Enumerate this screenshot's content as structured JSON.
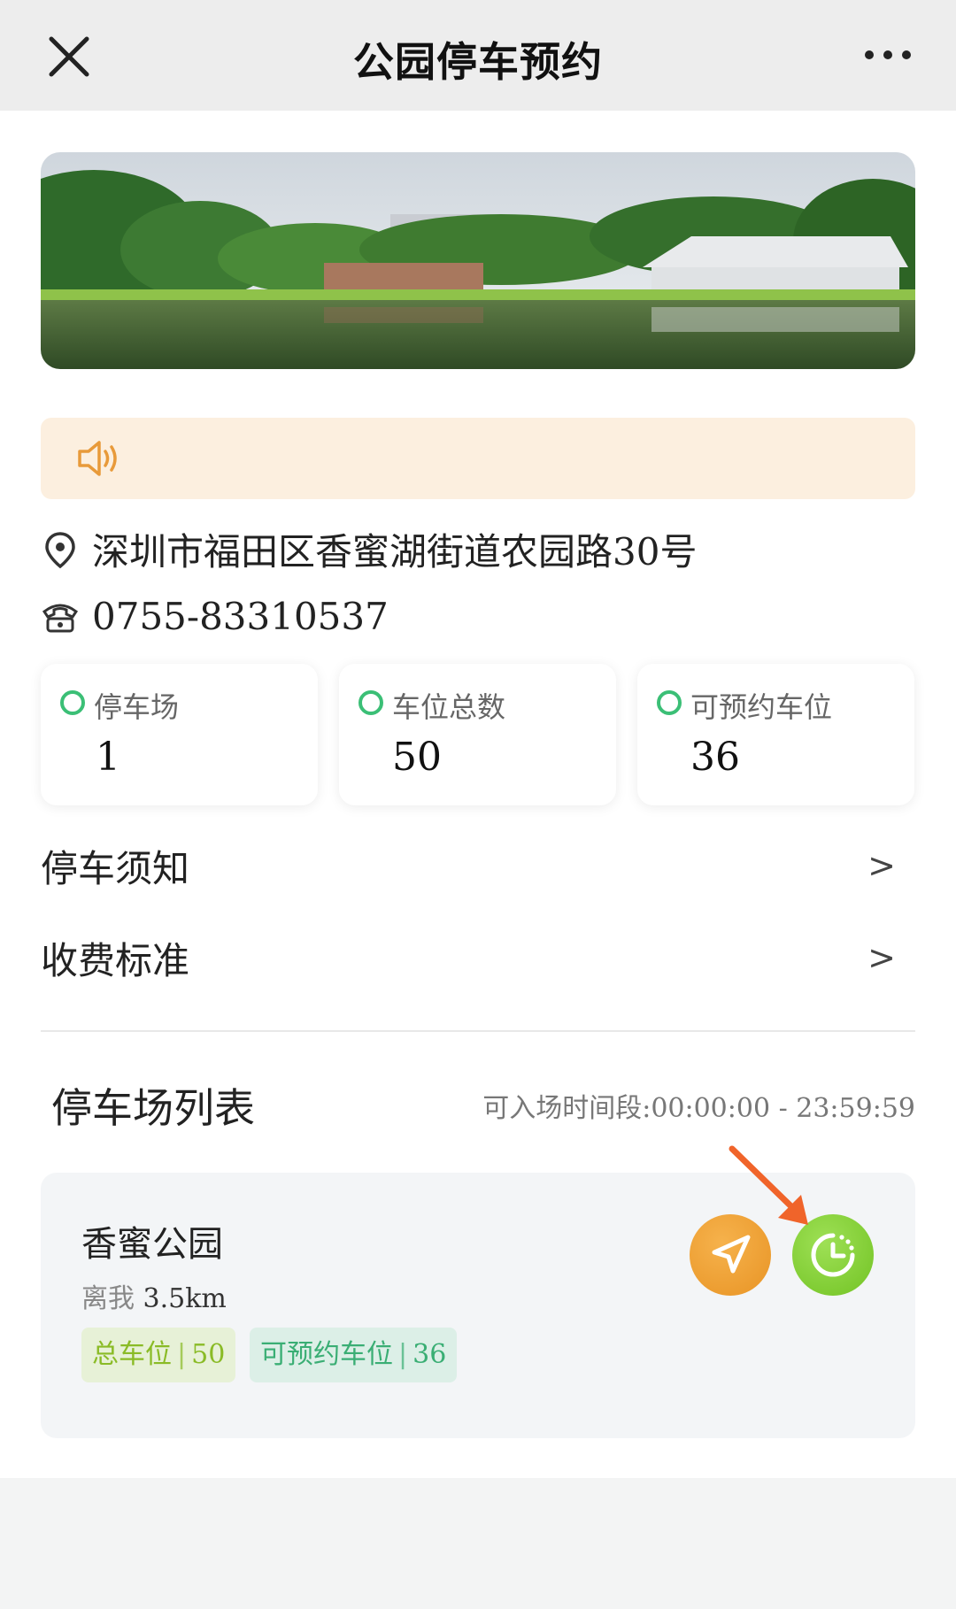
{
  "header": {
    "title": "公园停车预约"
  },
  "notice": {
    "text": ""
  },
  "park": {
    "address": "深圳市福田区香蜜湖街道农园路30号",
    "phone": "0755-83310537"
  },
  "stats": [
    {
      "label": "停车场",
      "value": "1"
    },
    {
      "label": "车位总数",
      "value": "50"
    },
    {
      "label": "可预约车位",
      "value": "36"
    }
  ],
  "menu": [
    {
      "label": "停车须知",
      "arrow": ">"
    },
    {
      "label": "收费标准",
      "arrow": ">"
    }
  ],
  "list": {
    "title": "停车场列表",
    "hours_label": "可入场时间段:",
    "hours": "00:00:00 - 23:59:59",
    "lots": [
      {
        "name": "香蜜公园",
        "distance_label": "离我",
        "distance": "3.5km",
        "total_label": "总车位",
        "total": "50",
        "avail_label": "可预约车位",
        "avail": "36"
      }
    ]
  },
  "icons": {
    "close": "close-icon",
    "more": "more-icon",
    "speaker": "speaker-icon",
    "location": "location-pin-icon",
    "phone": "phone-icon",
    "navigate": "navigate-icon",
    "clock": "clock-icon"
  },
  "colors": {
    "accent_green": "#3bbf76",
    "notice_bg": "#fcefdf",
    "nav_orange": "#ee9d2e",
    "time_green": "#7ccc2c",
    "hint_arrow": "#f0642a"
  }
}
